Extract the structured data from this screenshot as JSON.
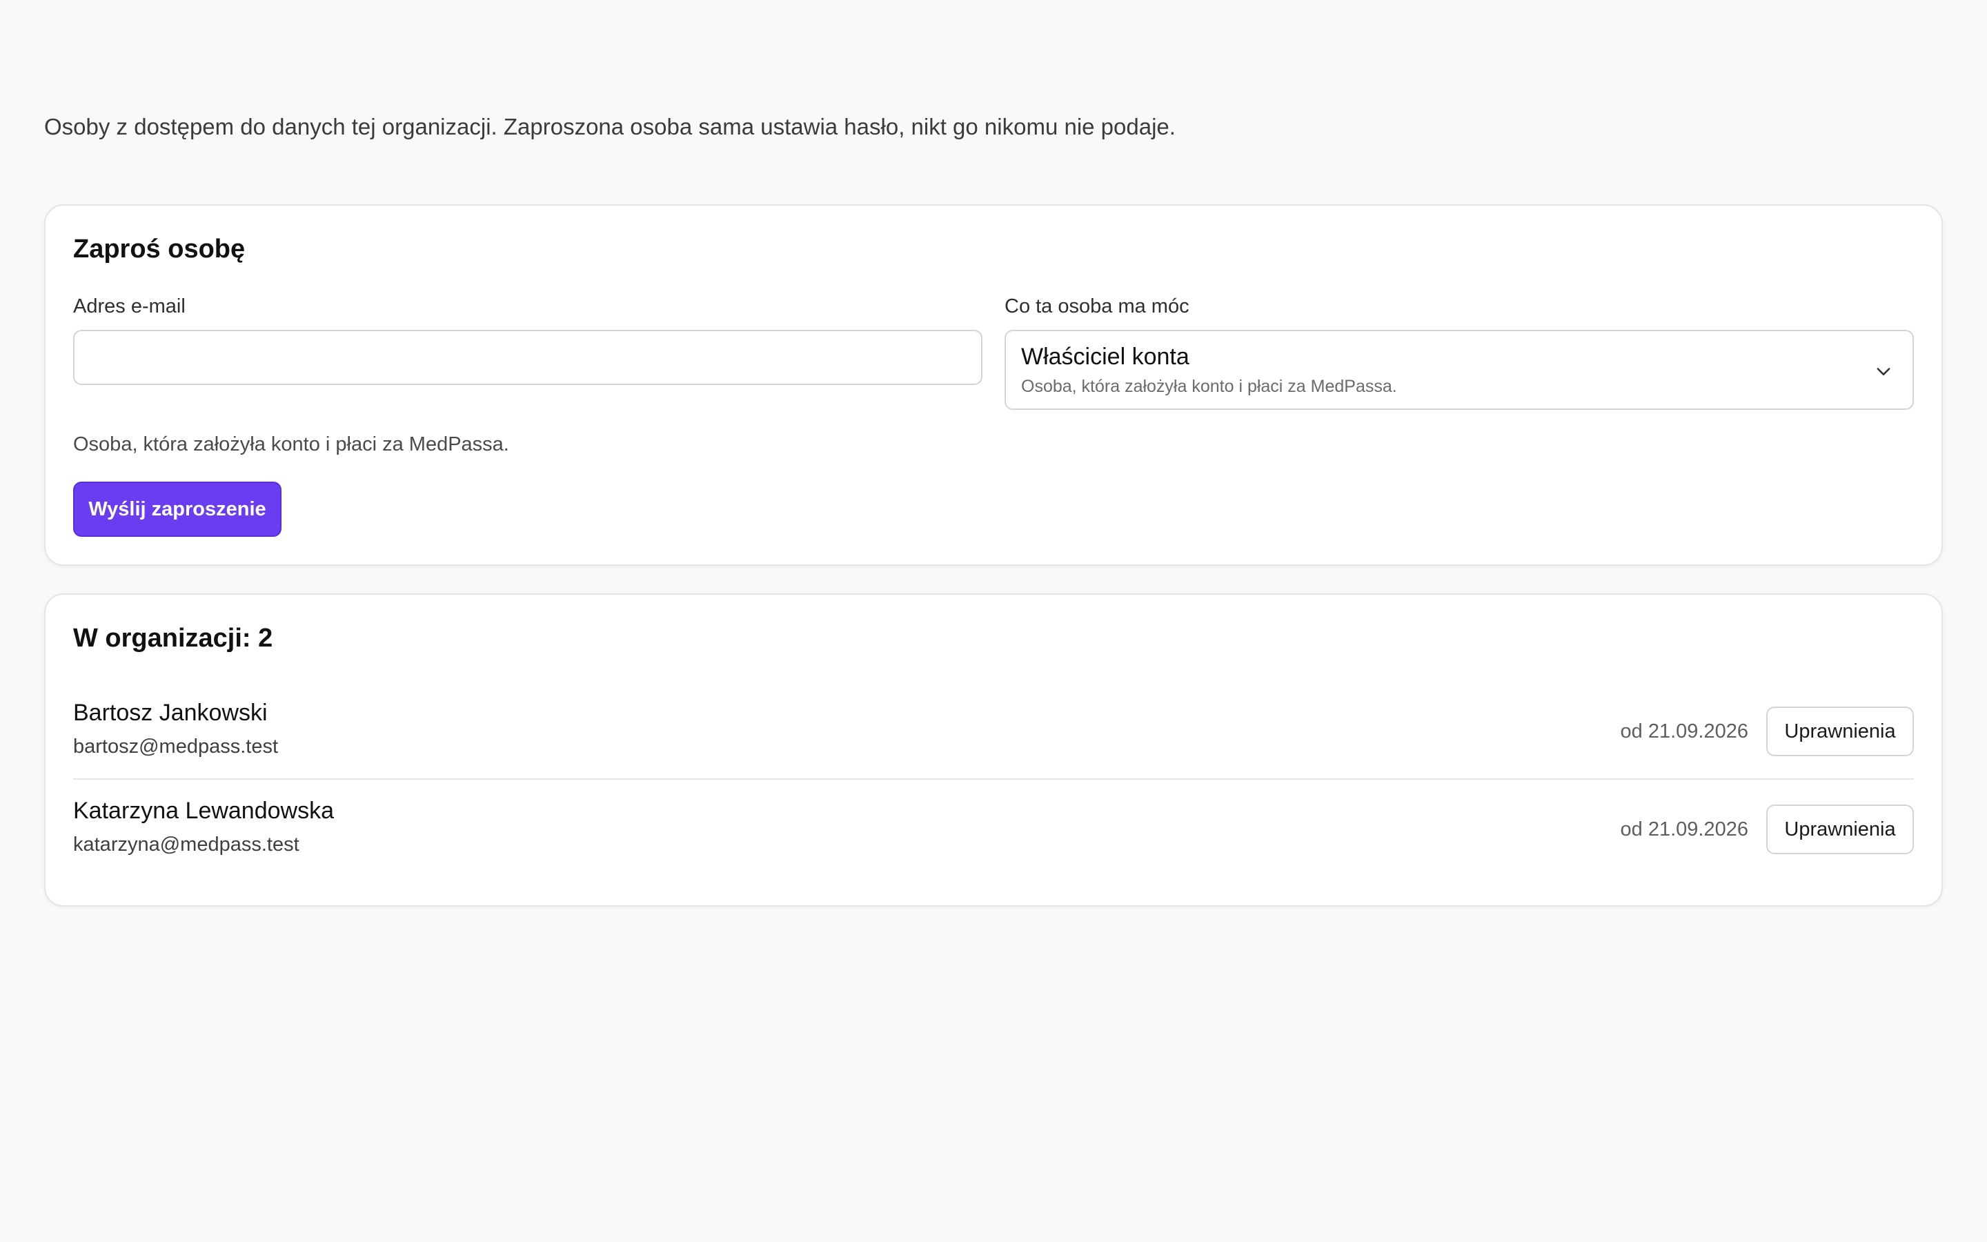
{
  "intro": {
    "text": "Osoby z dostępem do danych tej organizacji. Zaproszona osoba sama ustawia hasło, nikt go nikomu nie podaje."
  },
  "invite": {
    "title": "Zaproś osobę",
    "email_label": "Adres e-mail",
    "email_value": "",
    "email_placeholder": "",
    "role_label": "Co ta osoba ma móc",
    "role_selected": "Właściciel konta",
    "role_selected_description": "Osoba, która założyła konto i płaci za MedPassa.",
    "helper_text": "Osoba, która założyła konto i płaci za MedPassa.",
    "send_label": "Wyślij zaproszenie",
    "accent_color": "#6a3df0"
  },
  "members": {
    "title": "W organizacji: 2",
    "rows": [
      {
        "name": "Bartosz Jankowski",
        "email": "bartosz@medpass.test",
        "since": "od 21.09.2026",
        "button_label": "Uprawnienia"
      },
      {
        "name": "Katarzyna Lewandowska",
        "email": "katarzyna@medpass.test",
        "since": "od 21.09.2026",
        "button_label": "Uprawnienia"
      }
    ]
  },
  "icons": {
    "role_select_chevron": "chevron-down-icon"
  }
}
